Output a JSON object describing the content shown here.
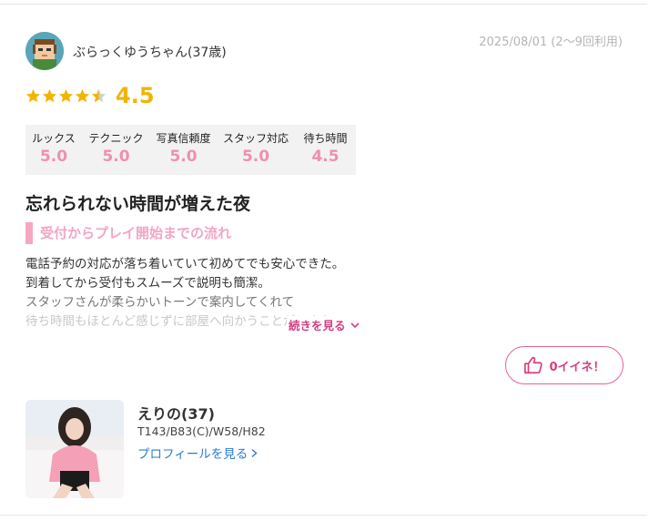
{
  "review": {
    "username": "ぶらっくゆうちゃん(37歳)",
    "meta": "2025/08/01 (2〜9回利用)",
    "overall_score": "4.5",
    "star_rating": 4.5,
    "ratings": [
      {
        "label": "ルックス",
        "value": "5.0"
      },
      {
        "label": "テクニック",
        "value": "5.0"
      },
      {
        "label": "写真信頼度",
        "value": "5.0"
      },
      {
        "label": "スタッフ対応",
        "value": "5.0"
      },
      {
        "label": "待ち時間",
        "value": "4.5"
      }
    ],
    "title": "忘れられない時間が増えた夜",
    "section_heading": "受付からプレイ開始までの流れ",
    "body_lines": [
      "電話予約の対応が落ち着いていて初めてでも安心できた。",
      "到着してから受付もスムーズで説明も簡潔。",
      "スタッフさんが柔らかいトーンで案内してくれて",
      "待ち時間もほとんど感じずに部屋へ向かうことができた"
    ],
    "read_more": "続きを見る",
    "like_label": "0イイネ！"
  },
  "girl": {
    "name": "えりの(37)",
    "sizes": "T143/B83(C)/W58/H82",
    "profile_link": "プロフィールを見る"
  },
  "colors": {
    "accent_pink": "#d63d83",
    "score_pink": "#f08fb0",
    "star_gold": "#f2b400",
    "link_blue": "#2b7bd4"
  },
  "icons": {
    "avatar": "pixel-avatar-icon",
    "star": "star-icon",
    "like": "thumbs-up-icon",
    "chevron": "chevron-down-icon"
  }
}
